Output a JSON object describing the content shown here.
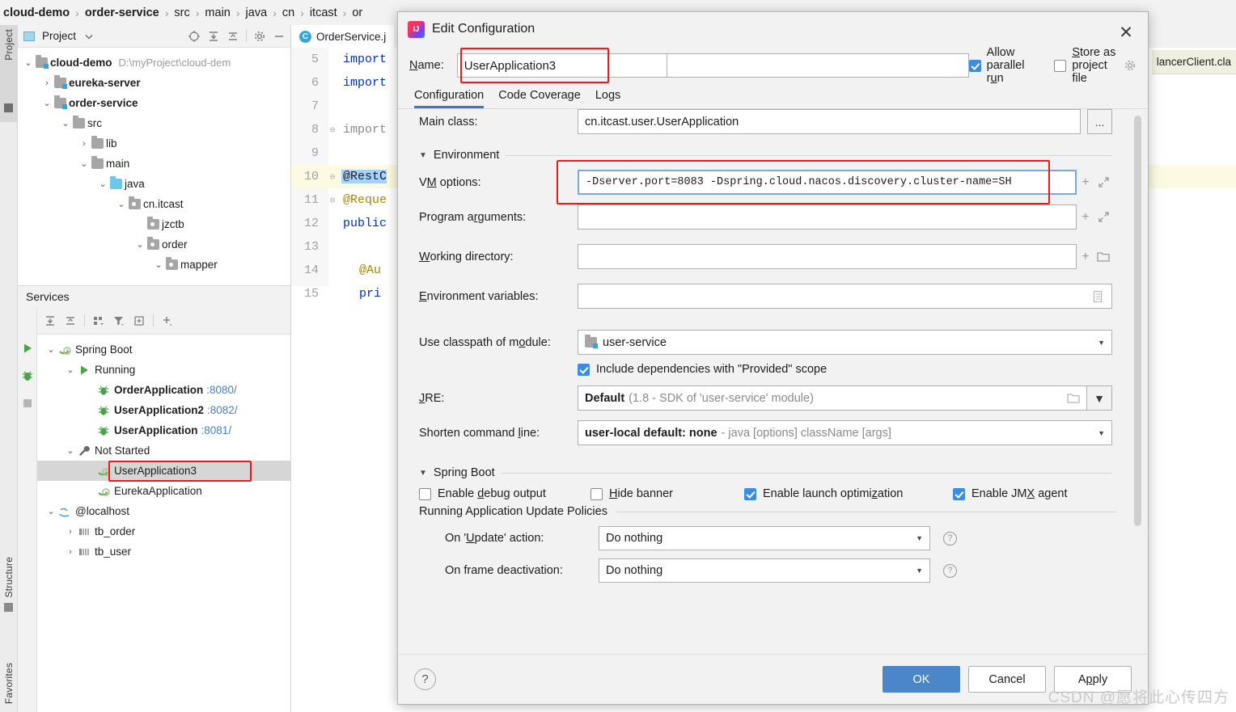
{
  "breadcrumb": {
    "items": [
      "cloud-demo",
      "order-service",
      "src",
      "main",
      "java",
      "cn",
      "itcast",
      "or"
    ],
    "separator": "›"
  },
  "left_strips": {
    "project_label": "Project",
    "structure_label": "Structure",
    "favorites_label": "Favorites"
  },
  "project_panel": {
    "title": "Project",
    "icons": [
      "project-view-icon",
      "chevron-down-icon",
      "locate-icon",
      "expand-all-icon",
      "collapse-all-icon",
      "gear-icon",
      "minimize-icon"
    ],
    "tree": [
      {
        "label": "cloud-demo",
        "path": "D:\\myProject\\cloud-dem",
        "indent": 0,
        "bold": true,
        "chev": "⌄",
        "icon": "module-folder"
      },
      {
        "label": "eureka-server",
        "path": "",
        "indent": 1,
        "bold": true,
        "chev": "›",
        "icon": "module-folder"
      },
      {
        "label": "order-service",
        "path": "",
        "indent": 1,
        "bold": true,
        "chev": "⌄",
        "icon": "module-folder"
      },
      {
        "label": "src",
        "path": "",
        "indent": 2,
        "bold": false,
        "chev": "⌄",
        "icon": "folder"
      },
      {
        "label": "lib",
        "path": "",
        "indent": 3,
        "bold": false,
        "chev": "›",
        "icon": "folder"
      },
      {
        "label": "main",
        "path": "",
        "indent": 3,
        "bold": false,
        "chev": "⌄",
        "icon": "folder"
      },
      {
        "label": "java",
        "path": "",
        "indent": 4,
        "bold": false,
        "chev": "⌄",
        "icon": "source-folder"
      },
      {
        "label": "cn.itcast",
        "path": "",
        "indent": 5,
        "bold": false,
        "chev": "⌄",
        "icon": "package"
      },
      {
        "label": "jzctb",
        "path": "",
        "indent": 6,
        "bold": false,
        "chev": "",
        "icon": "package"
      },
      {
        "label": "order",
        "path": "",
        "indent": 6,
        "bold": false,
        "chev": "⌄",
        "icon": "package"
      },
      {
        "label": "mapper",
        "path": "",
        "indent": 7,
        "bold": false,
        "chev": "⌄",
        "icon": "package"
      }
    ]
  },
  "services_panel": {
    "title": "Services",
    "left_icons": [
      "run-icon",
      "debug-icon",
      "stop-icon"
    ],
    "toolbar_icons": [
      "expand-all-icon",
      "collapse-all-icon",
      "group-by-icon",
      "filter-icon",
      "add-tab-icon",
      "add-icon"
    ],
    "tree": [
      {
        "label": "Spring Boot",
        "port": "",
        "indent": 0,
        "chev": "⌄",
        "icon": "spring-boot-icon",
        "bold": false,
        "selected": false
      },
      {
        "label": "Running",
        "port": "",
        "indent": 1,
        "chev": "⌄",
        "icon": "run-icon",
        "bold": false,
        "selected": false
      },
      {
        "label": "OrderApplication",
        "port": ":8080/",
        "indent": 2,
        "chev": "",
        "icon": "spring-bean-icon",
        "bold": true,
        "selected": false
      },
      {
        "label": "UserApplication2",
        "port": ":8082/",
        "indent": 2,
        "chev": "",
        "icon": "spring-bean-icon",
        "bold": true,
        "selected": false
      },
      {
        "label": "UserApplication",
        "port": ":8081/",
        "indent": 2,
        "chev": "",
        "icon": "spring-bean-icon",
        "bold": true,
        "selected": false
      },
      {
        "label": "Not Started",
        "port": "",
        "indent": 1,
        "chev": "⌄",
        "icon": "wrench-icon",
        "bold": false,
        "selected": false
      },
      {
        "label": "UserApplication3",
        "port": "",
        "indent": 2,
        "chev": "",
        "icon": "spring-boot-icon",
        "bold": false,
        "selected": true
      },
      {
        "label": "EurekaApplication",
        "port": "",
        "indent": 2,
        "chev": "",
        "icon": "spring-boot-icon",
        "bold": false,
        "selected": false
      },
      {
        "label": "@localhost",
        "port": "",
        "indent": 0,
        "chev": "⌄",
        "icon": "database-icon",
        "bold": false,
        "selected": false
      },
      {
        "label": "tb_order",
        "port": "",
        "indent": 1,
        "chev": "›",
        "icon": "table-icon",
        "bold": false,
        "selected": false
      },
      {
        "label": "tb_user",
        "port": "",
        "indent": 1,
        "chev": "›",
        "icon": "table-icon",
        "bold": false,
        "selected": false
      }
    ]
  },
  "editor": {
    "tab_label": "OrderService.j",
    "tab_icon": "class-icon",
    "right_tab_label": "lancerClient.cla",
    "lines": [
      {
        "num": "5",
        "text": "import",
        "cls": "kw",
        "fold": ""
      },
      {
        "num": "6",
        "text": "import",
        "cls": "kw",
        "fold": ""
      },
      {
        "num": "7",
        "text": "",
        "cls": "",
        "fold": ""
      },
      {
        "num": "8",
        "text": "import",
        "cls": "grey",
        "fold": "⊖"
      },
      {
        "num": "9",
        "text": "",
        "cls": "",
        "fold": ""
      },
      {
        "num": "10",
        "text": "@RestC",
        "cls": "sel",
        "fold": "⊖"
      },
      {
        "num": "11",
        "text": "@Reque",
        "cls": "ann",
        "fold": "⊖"
      },
      {
        "num": "12",
        "text": "public",
        "cls": "kw",
        "fold": ""
      },
      {
        "num": "13",
        "text": "",
        "cls": "",
        "fold": ""
      },
      {
        "num": "14",
        "text": "@Au",
        "cls": "ann",
        "fold": ""
      },
      {
        "num": "15",
        "text": "pri",
        "cls": "kw",
        "fold": ""
      }
    ]
  },
  "dialog": {
    "title": "Edit Configuration",
    "close_label": "✕",
    "name_label_pre": "N",
    "name_label_post": "ame:",
    "name_value": "UserApplication3",
    "allow_parallel_run": {
      "label_pre": "Allow parallel r",
      "label_u": "u",
      "label_post": "n",
      "checked": true
    },
    "store_as_project_file": {
      "label_pre": "",
      "label_u": "S",
      "label_post": "tore as project file",
      "checked": false
    },
    "tabs": [
      {
        "label": "Configuration",
        "active": true
      },
      {
        "label": "Code Coverage",
        "active": false
      },
      {
        "label": "Logs",
        "active": false
      }
    ],
    "fields": {
      "main_class": {
        "label": "Main class:",
        "value": "cn.itcast.user.UserApplication",
        "button": "..."
      },
      "environment_section": "Environment",
      "vm_options": {
        "label_pre": "V",
        "label_u": "M",
        "label_post": " options:",
        "value": "-Dserver.port=8083 -Dspring.cloud.nacos.discovery.cluster-name=SH",
        "icons": [
          "add-macro-icon",
          "expand-icon"
        ]
      },
      "program_arguments": {
        "label_pre": "Program a",
        "label_u": "r",
        "label_post": "guments:",
        "value": "",
        "icons": [
          "add-macro-icon",
          "expand-icon"
        ]
      },
      "working_directory": {
        "label_pre": "",
        "label_u": "W",
        "label_post": "orking directory:",
        "value": "",
        "icons": [
          "add-macro-icon",
          "folder-icon"
        ]
      },
      "environment_variables": {
        "label_pre": "",
        "label_u": "E",
        "label_post": "nvironment variables:",
        "value": "",
        "icons": [
          "list-icon"
        ]
      },
      "use_classpath_of_module": {
        "label_pre": "Use classpath of m",
        "label_u": "o",
        "label_post": "dule:",
        "value": "user-service",
        "icon": "module-icon",
        "arrow": "▼"
      },
      "include_provided": {
        "label": "Include dependencies with \"Provided\" scope",
        "checked": true
      },
      "jre": {
        "label_pre": "",
        "label_u": "J",
        "label_post": "RE:",
        "value_bold": "Default",
        "value_grey": "(1.8 - SDK of 'user-service' module)",
        "icons": [
          "folder-icon"
        ],
        "arrow": "▼"
      },
      "shorten_command_line": {
        "label_pre": "Shorten command ",
        "label_u": "l",
        "label_post": "ine:",
        "value_bold": "user-local default: none",
        "value_grey": "- java [options] className [args]",
        "arrow": "▼"
      }
    },
    "spring_boot": {
      "section_label": "Spring Boot",
      "checkboxes": [
        {
          "label_pre": "Enable ",
          "label_u": "d",
          "label_post": "ebug output",
          "checked": false
        },
        {
          "label_pre": "",
          "label_u": "H",
          "label_post": "ide banner",
          "checked": false
        },
        {
          "label_pre": "Enable launch optimi",
          "label_u": "z",
          "label_post": "ation",
          "checked": true
        },
        {
          "label_pre": "Enable JM",
          "label_u": "X",
          "label_post": " agent",
          "checked": true
        }
      ],
      "update_policies": {
        "title": "Running Application Update Policies",
        "rows": [
          {
            "label_pre": "On '",
            "label_u": "U",
            "label_post": "pdate' action:",
            "value": "Do nothing",
            "arrow": "▼",
            "help": "?"
          },
          {
            "label_pre": "On frame deactivation:",
            "label_u": "",
            "label_post": "",
            "value": "Do nothing",
            "arrow": "▼",
            "help": "?"
          }
        ]
      }
    },
    "footer": {
      "help": "?",
      "ok": "OK",
      "cancel": "Cancel",
      "apply_pre": "A",
      "apply_u": "p",
      "apply_post": "ply"
    }
  },
  "watermark": "CSDN @愿将此心传四方",
  "colors": {
    "accent_blue": "#4a86c8",
    "tab_underline": "#3c79c4",
    "checkbox_blue": "#3c8de0",
    "highlight_red": "#ef1b1b",
    "selection_blue": "#a6d2ff",
    "port_link": "#4a7ebb"
  }
}
